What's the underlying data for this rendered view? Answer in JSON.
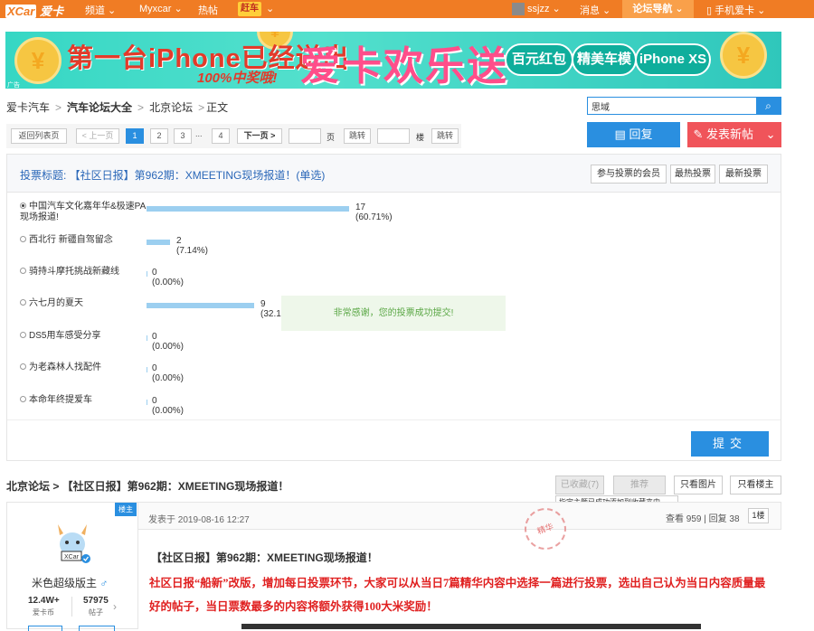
{
  "topnav": {
    "logo": "XCar",
    "logo_brand": "爱卡",
    "items": [
      "频道",
      "Myxcar",
      "热帖"
    ],
    "hot_badge": "赶车",
    "username": "ssjzz",
    "messages": "消息",
    "forum_nav": "论坛导航",
    "mobile": "手机爱卡"
  },
  "banner": {
    "headline": "第一台iPhone已经送出",
    "subline": "100%中奖哦!",
    "brand": "爱卡欢乐送",
    "pills": [
      "百元红包",
      "精美车模",
      "iPhone XS"
    ],
    "corner": "广告",
    "coin_symbol": "¥"
  },
  "breadcrumb": [
    "爱卡汽车",
    "汽车论坛大全",
    "北京论坛",
    "正文"
  ],
  "search": {
    "value": "思域",
    "icon": "search-icon"
  },
  "pager": {
    "back": "返回列表页",
    "prev": "< 上一页",
    "pages": [
      "1",
      "2",
      "3",
      "...",
      "4"
    ],
    "next": "下一页 >",
    "page_unit": "页",
    "jump": "跳转",
    "floor_unit": "楼",
    "jump2": "跳转"
  },
  "actions": {
    "reply": "回复",
    "new_post": "发表新帖"
  },
  "poll": {
    "title": "投票标题: 【社区日报】第962期：XMEETING现场报道！(单选)",
    "tabs": [
      "参与投票的会员",
      "最热投票",
      "最新投票"
    ],
    "options": [
      {
        "label": "中国汽车文化嘉年华&极速PA现场报道!",
        "value": "17 (60.71%)",
        "pct": 60.71,
        "selected": true
      },
      {
        "label": "西北行 新疆自驾留念",
        "value": "2 (7.14%)",
        "pct": 7.14,
        "selected": false
      },
      {
        "label": "骑持斗摩托挑战新藏线",
        "value": "0 (0.00%)",
        "pct": 0,
        "selected": false
      },
      {
        "label": "六七月的夏天",
        "value": "9 (32.1",
        "pct": 32.14,
        "selected": false
      },
      {
        "label": "DS5用车感受分享",
        "value": "0 (0.00%)",
        "pct": 0,
        "selected": false
      },
      {
        "label": "为老森林人找配件",
        "value": "0 (0.00%)",
        "pct": 0,
        "selected": false
      },
      {
        "label": "本命年终提爱车",
        "value": "0 (0.00%)",
        "pct": 0,
        "selected": false
      }
    ],
    "toast": "非常感谢，您的投票成功提交!",
    "submit": "提交"
  },
  "thread": {
    "title": "北京论坛 > 【社区日报】第962期：XMEETING现场报道！",
    "buttons": [
      "已收藏(7)",
      "推荐",
      "只看图片",
      "只看楼主"
    ],
    "tip": "指定主题已成功添加到收藏夹中。"
  },
  "author": {
    "host_tag": "楼主",
    "name": "米色超级版主",
    "sex_symbol": "♂",
    "coins": "12.4W+",
    "coins_label": "爱卡币",
    "posts": "57975",
    "posts_label": "帖子"
  },
  "post": {
    "date": "发表于 2019-08-16 12:27",
    "views_replies": "查看 959 | 回复 38",
    "floor": "1楼",
    "stamp": "精华",
    "heading": "【社区日报】第962期：XMEETING现场报道！",
    "body": "社区日报“船新”改版，增加每日投票环节，大家可以从当日7篇精华内容中选择一篇进行投票，选出自己认为当日内容质量最好的帖子，当日票数最多的内容将额外获得100大米奖励！"
  },
  "colors": {
    "nav": "#f07c24",
    "accent": "#2a8fe0",
    "danger": "#f0545a",
    "bar": "#9ccff0"
  }
}
